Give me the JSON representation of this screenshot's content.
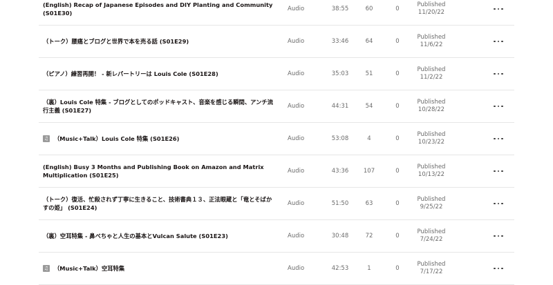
{
  "episodes": [
    {
      "title": "(English) Recap of Japanese Episodes and DIY Planting and Community (S01E30)",
      "icon": "",
      "type": "Audio",
      "duration": "38:55",
      "plays": "60",
      "zero": "0",
      "status": "Published",
      "date": "11/20/22"
    },
    {
      "title": "（トーク）腰痛とブログと世界で本を売る話 (S01E29)",
      "icon": "",
      "type": "Audio",
      "duration": "33:46",
      "plays": "64",
      "zero": "0",
      "status": "Published",
      "date": "11/6/22"
    },
    {
      "title": "（ピアノ）練習再開！ - 新レパートリーは Louis Cole (S01E28)",
      "icon": "",
      "type": "Audio",
      "duration": "35:03",
      "plays": "51",
      "zero": "0",
      "status": "Published",
      "date": "11/2/22"
    },
    {
      "title": "（裏）Louis Cole 特集 - ブログとしてのポッドキャスト、音楽を感じる瞬間、アンチ流行主義 (S01E27)",
      "icon": "",
      "type": "Audio",
      "duration": "44:31",
      "plays": "54",
      "zero": "0",
      "status": "Published",
      "date": "10/28/22"
    },
    {
      "title": "（Music+Talk）Louis Cole 特集 (S01E26)",
      "icon": "music-note-icon",
      "type": "Audio",
      "duration": "53:08",
      "plays": "4",
      "zero": "0",
      "status": "Published",
      "date": "10/23/22"
    },
    {
      "title": "(English) Busy 3 Months and Publishing Book on Amazon and Matrix Multiplication (S01E25)",
      "icon": "",
      "type": "Audio",
      "duration": "43:36",
      "plays": "107",
      "zero": "0",
      "status": "Published",
      "date": "10/13/22"
    },
    {
      "title": "（トーク）復活、忙殺されず丁寧に生きること、技術書典１３、正法眼蔵と「竜とそばかすの姫」 (S01E24)",
      "icon": "",
      "type": "Audio",
      "duration": "51:50",
      "plays": "63",
      "zero": "0",
      "status": "Published",
      "date": "9/25/22"
    },
    {
      "title": "（裏）空耳特集 - 鼻べちゃと人生の基本とVulcan Salute (S01E23)",
      "icon": "",
      "type": "Audio",
      "duration": "30:48",
      "plays": "72",
      "zero": "0",
      "status": "Published",
      "date": "7/24/22"
    },
    {
      "title": "（Music+Talk）空耳特集",
      "icon": "music-note-icon",
      "type": "Audio",
      "duration": "42:53",
      "plays": "1",
      "zero": "0",
      "status": "Published",
      "date": "7/17/22"
    }
  ]
}
